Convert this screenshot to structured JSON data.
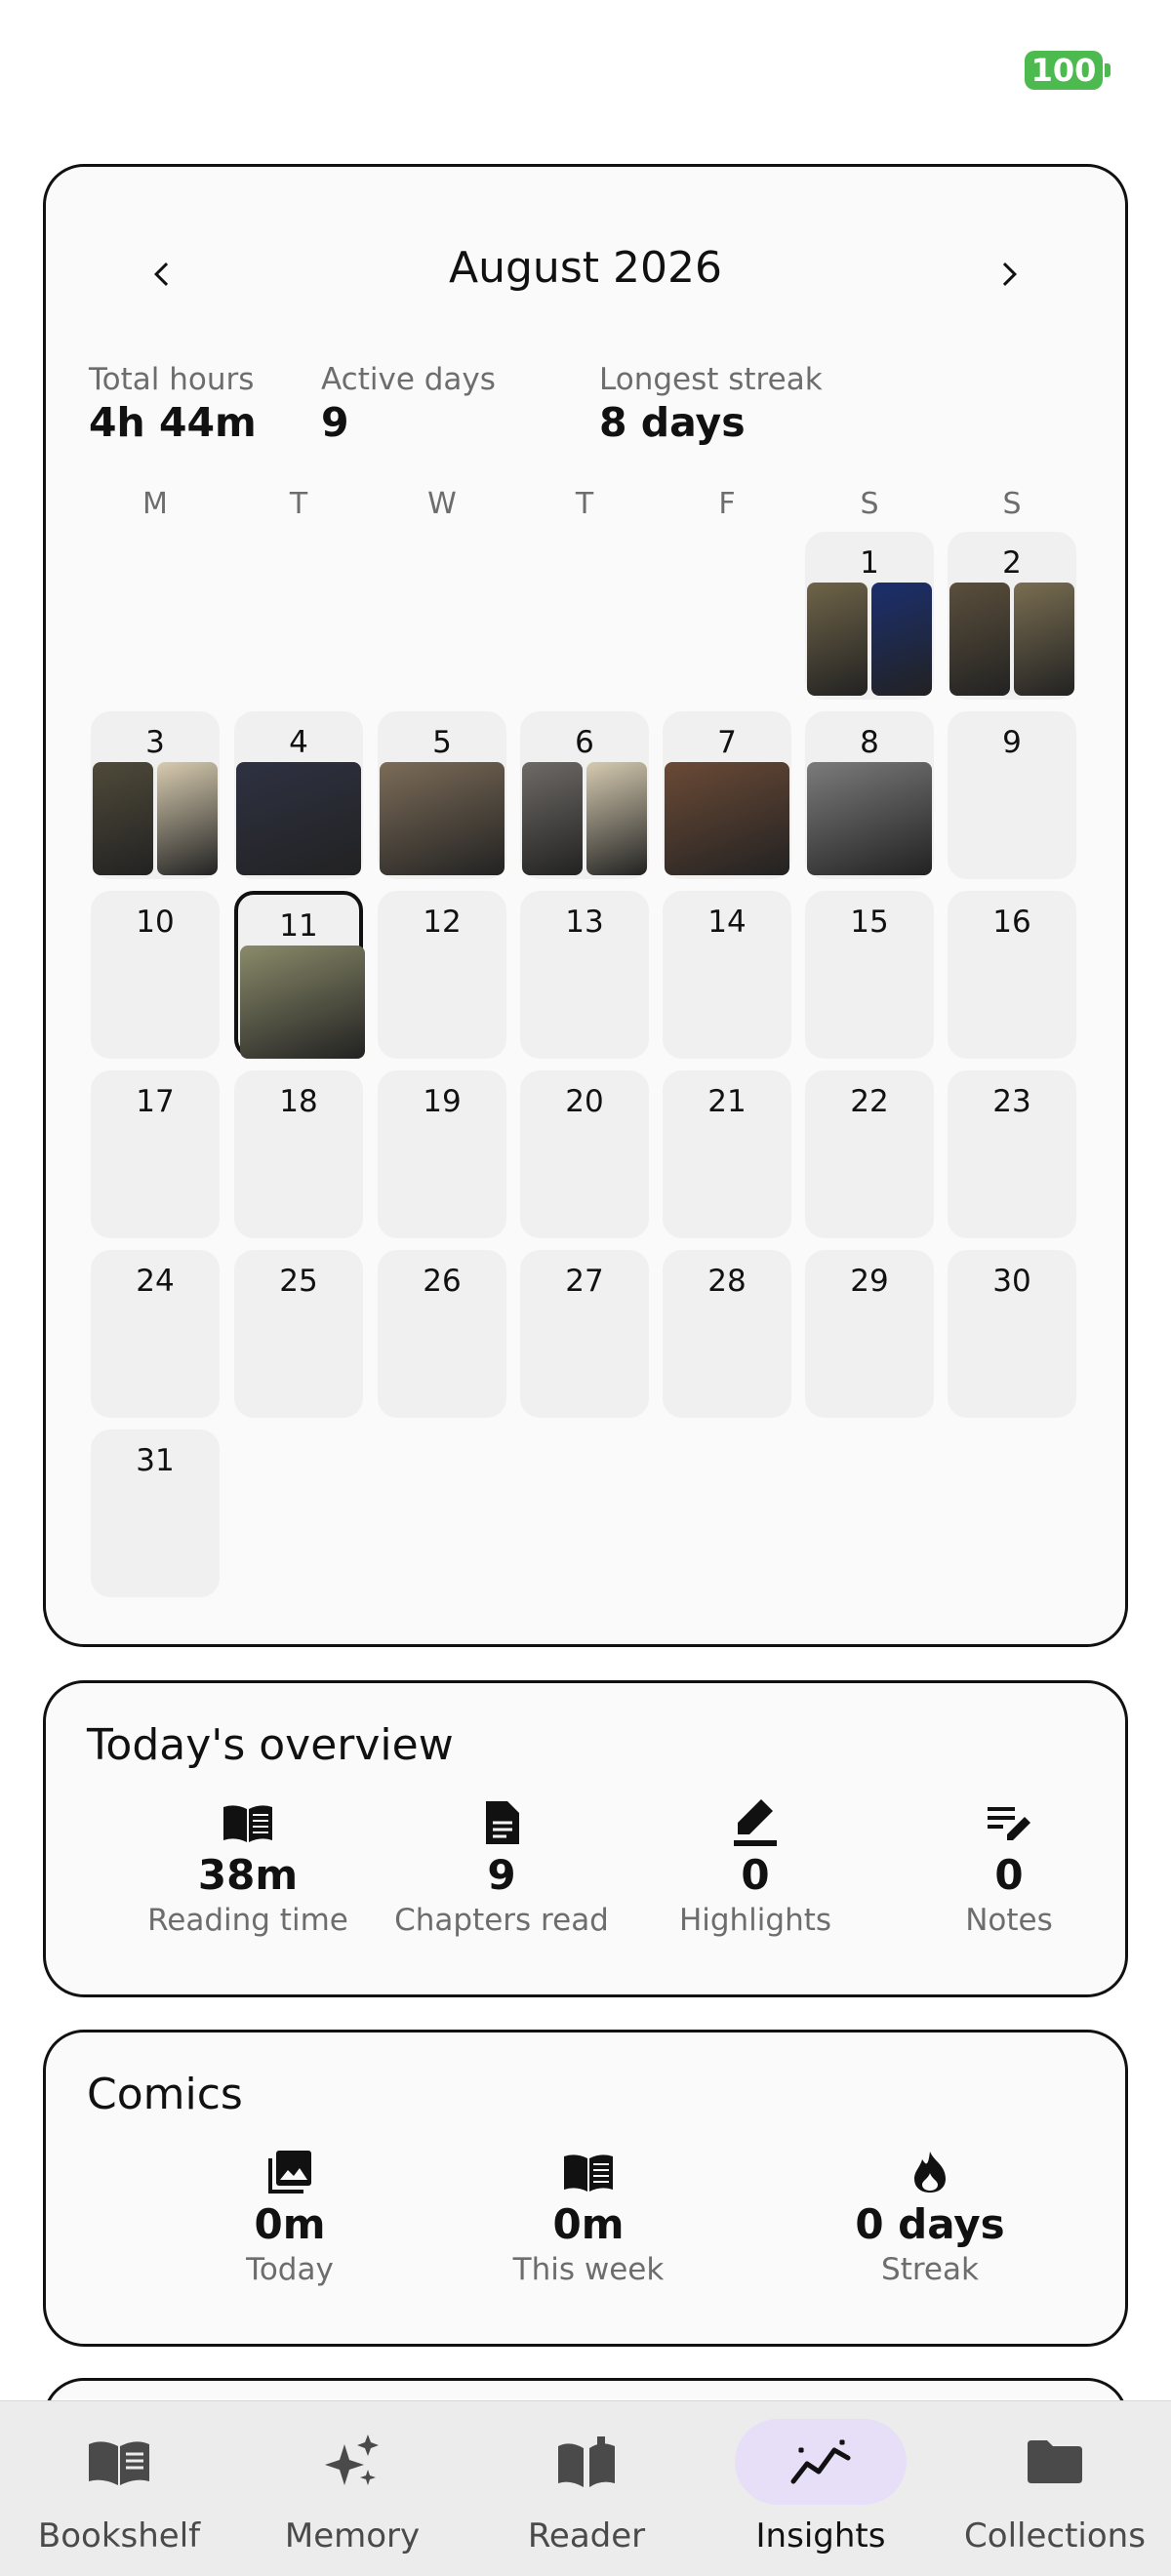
{
  "status": {
    "battery": "100"
  },
  "calendar": {
    "month_title": "August 2026",
    "stats": [
      {
        "label": "Total hours",
        "value": "4h 44m"
      },
      {
        "label": "Active days",
        "value": "9"
      },
      {
        "label": "Longest streak",
        "value": "8 days"
      }
    ],
    "weekdays": [
      "M",
      "T",
      "W",
      "T",
      "F",
      "S",
      "S"
    ],
    "first_weekday_index": 5,
    "days_in_month": 31,
    "selected_day": 11,
    "day_covers": {
      "1": [
        "#6f6448",
        "#1b2f6e"
      ],
      "2": [
        "#5b4f3c",
        "#7a6e52"
      ],
      "3": [
        "#4f4a39",
        "#d8ccb0"
      ],
      "4": [
        "#2e3142"
      ],
      "5": [
        "#7c6c58"
      ],
      "6": [
        "#6e6a66",
        "#d6cbb1"
      ],
      "7": [
        "#6b4a36"
      ],
      "8": [
        "#7b7b7b"
      ],
      "11": [
        "#8a8a6a"
      ]
    }
  },
  "overview": {
    "title": "Today's overview",
    "metrics": [
      {
        "icon": "open-book-icon",
        "value": "38m",
        "label": "Reading time"
      },
      {
        "icon": "document-icon",
        "value": "9",
        "label": "Chapters read"
      },
      {
        "icon": "highlighter-icon",
        "value": "0",
        "label": "Highlights"
      },
      {
        "icon": "note-edit-icon",
        "value": "0",
        "label": "Notes"
      }
    ]
  },
  "comics": {
    "title": "Comics",
    "metrics": [
      {
        "icon": "image-stack-icon",
        "value": "0m",
        "label": "Today"
      },
      {
        "icon": "open-book-icon",
        "value": "0m",
        "label": "This week"
      },
      {
        "icon": "flame-icon",
        "value": "0 days",
        "label": "Streak"
      }
    ]
  },
  "bottom_nav": {
    "active": "Insights",
    "items": [
      {
        "label": "Bookshelf",
        "icon": "book-icon"
      },
      {
        "label": "Memory",
        "icon": "sparkle-icon"
      },
      {
        "label": "Reader",
        "icon": "reader-book-icon"
      },
      {
        "label": "Insights",
        "icon": "trend-icon"
      },
      {
        "label": "Collections",
        "icon": "folder-icon"
      }
    ]
  },
  "colors": {
    "accent_pill": "#e7dff8",
    "battery": "#4cba4f",
    "day_cell": "#f0f0f0"
  }
}
